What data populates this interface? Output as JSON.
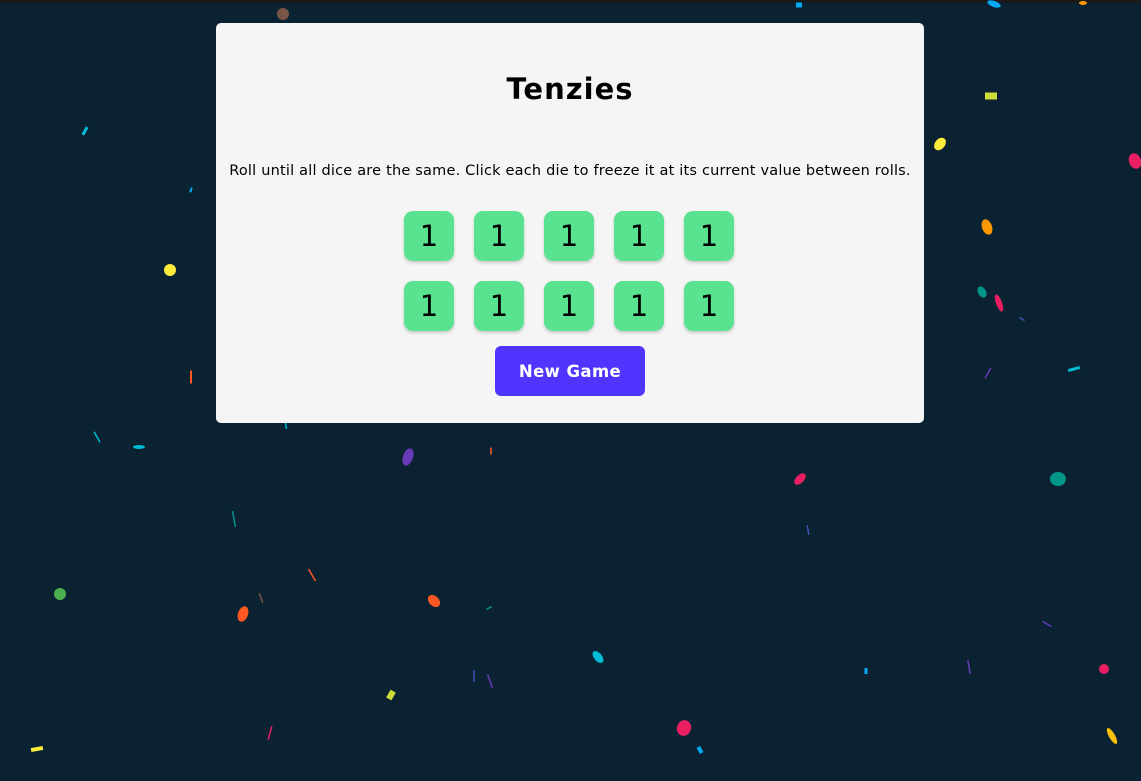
{
  "app": {
    "title": "Tenzies",
    "instructions": "Roll until all dice are the same. Click each die to freeze it at its current value between rolls."
  },
  "dice": [
    {
      "value": "1",
      "held": true
    },
    {
      "value": "1",
      "held": true
    },
    {
      "value": "1",
      "held": true
    },
    {
      "value": "1",
      "held": true
    },
    {
      "value": "1",
      "held": true
    },
    {
      "value": "1",
      "held": true
    },
    {
      "value": "1",
      "held": true
    },
    {
      "value": "1",
      "held": true
    },
    {
      "value": "1",
      "held": true
    },
    {
      "value": "1",
      "held": true
    }
  ],
  "actions": {
    "new_game_label": "New Game"
  },
  "colors": {
    "background": "#0b2233",
    "board": "#f5f5f5",
    "held_die": "#59e391",
    "button": "#5035ff",
    "confetti": [
      "#e91e63",
      "#2196f3",
      "#ffeb3b",
      "#ffc107",
      "#4caf50",
      "#009688",
      "#00bcd4",
      "#673ab7",
      "#3f51b5",
      "#ff5722",
      "#cddc39",
      "#795548",
      "#03a9f4",
      "#ff9800"
    ]
  }
}
